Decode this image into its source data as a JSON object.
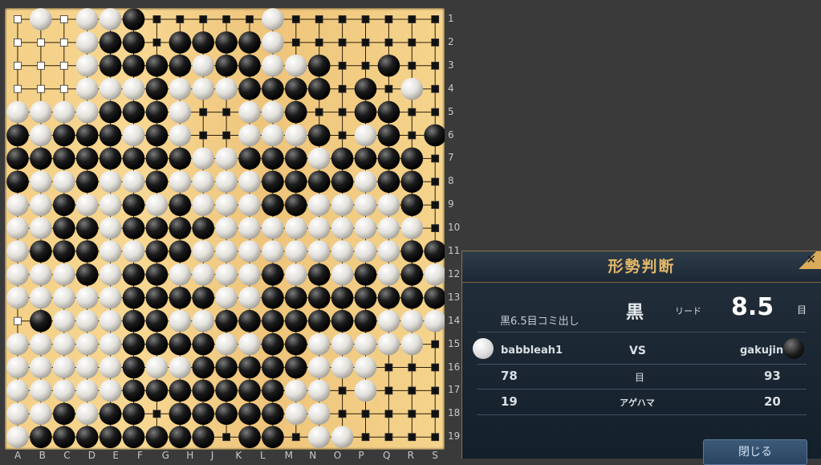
{
  "board": {
    "size": 19,
    "col_labels": [
      "A",
      "B",
      "C",
      "D",
      "E",
      "F",
      "G",
      "H",
      "J",
      "K",
      "L",
      "M",
      "N",
      "O",
      "P",
      "Q",
      "R",
      "S"
    ],
    "row_labels": [
      "1",
      "2",
      "3",
      "4",
      "5",
      "6",
      "7",
      "8",
      "9",
      "10",
      "11",
      "12",
      "13",
      "14",
      "15",
      "16",
      "17",
      "18",
      "19"
    ],
    "rows": [
      ".W.WWB.....W.......",
      "...WBB.BBBBW.......",
      "...WBBBBWBBWWB..B..",
      "...WWWBWWWBBBB.B.W.",
      "WWWWBBBW..WWB..BB..",
      "BWBBBWBW..WWWB.WB.B",
      "BBBBBBBBWWBBBWBBBB.",
      "BWWBWWBWWWWBBBBWBB.",
      "WWBWWBWBWWWBBWWWWB.",
      "WWBBWBBBBWWWWWWWWW.",
      "WBBBWWBBWWWWWWWWWBB",
      "WWWBWBBWWWWBWBWBWBW",
      "WWWWWBBBBWWBBBBBBBB",
      ".BWWWBBWWBBBBBBBWWW",
      "WWWWWBBBBWWBBWWWWW.",
      "WWWWWBWWBBBBBWWW...",
      "WWWWWBBBBBBBWW.W...",
      "WWBWBB.BBBBBWW.....",
      "WBBBBBBBB.BB.WW...."
    ],
    "territory_marks_note": "territory shown as small squares"
  },
  "panel": {
    "title": "形勢判断",
    "leader": "黒",
    "lead_label": "リード",
    "lead_value": "8.5",
    "lead_unit": "目",
    "komi_note": "黒6.5目コミ出し",
    "vs_label": "VS",
    "white_player": "babbleah1",
    "black_player": "gakujin",
    "points_label": "目",
    "white_points": "78",
    "black_points": "93",
    "captures_label": "アゲハマ",
    "white_captures": "19",
    "black_captures": "20",
    "close_label": "閉じる",
    "close_x": "✕"
  }
}
